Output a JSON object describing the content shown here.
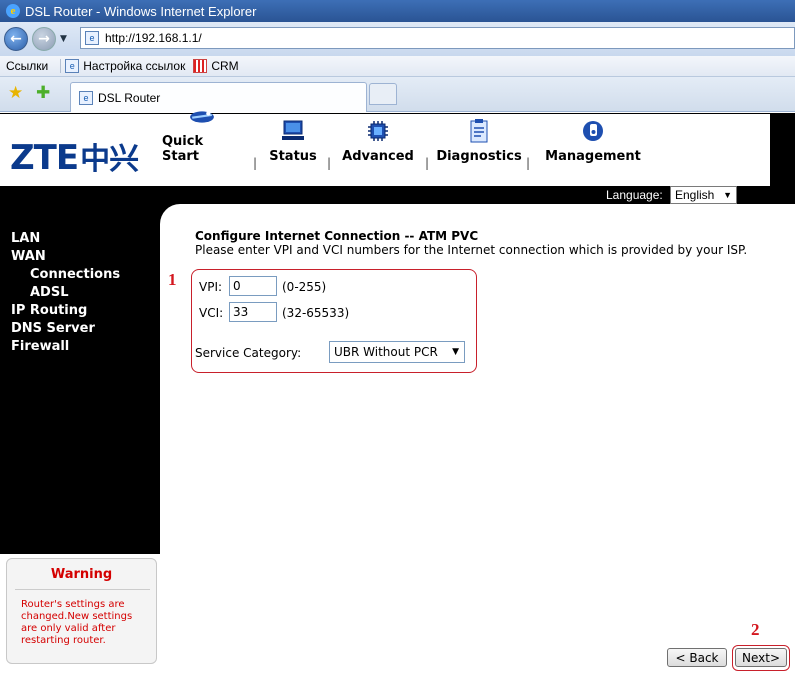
{
  "browser": {
    "window_title": "DSL Router - Windows Internet Explorer",
    "address": "http://192.168.1.1/",
    "links_bar": [
      "Ссылки",
      "Настройка ссылок",
      "CRM"
    ],
    "tab_title": "DSL Router"
  },
  "header": {
    "logo": "ZTE",
    "logo_cn": "中兴",
    "menu": [
      "Quick Start",
      "Status",
      "Advanced",
      "Diagnostics",
      "Management"
    ]
  },
  "language": {
    "label": "Language:",
    "value": "English"
  },
  "sidebar": {
    "items": [
      "LAN",
      "WAN",
      "Connections",
      "ADSL",
      "IP Routing",
      "DNS Server",
      "Firewall"
    ]
  },
  "page": {
    "title": "Configure Internet Connection -- ATM PVC",
    "description": "Please enter VPI and VCI numbers for the Internet connection which is provided by your ISP."
  },
  "form": {
    "vpi_label": "VPI:",
    "vpi_value": "0",
    "vpi_range": "(0-255)",
    "vci_label": "VCI:",
    "vci_value": "33",
    "vci_range": "(32-65533)",
    "service_label": "Service Category:",
    "service_value": "UBR Without PCR"
  },
  "annotations": [
    "1",
    "2"
  ],
  "warning": {
    "title": "Warning",
    "message": "Router's settings are changed.New settings are only valid after restarting router."
  },
  "buttons": {
    "back": "< Back",
    "next": "Next>"
  },
  "colors": {
    "logo": "#0b3a8c",
    "annotation": "#d4171f",
    "warning": "#d40000"
  }
}
